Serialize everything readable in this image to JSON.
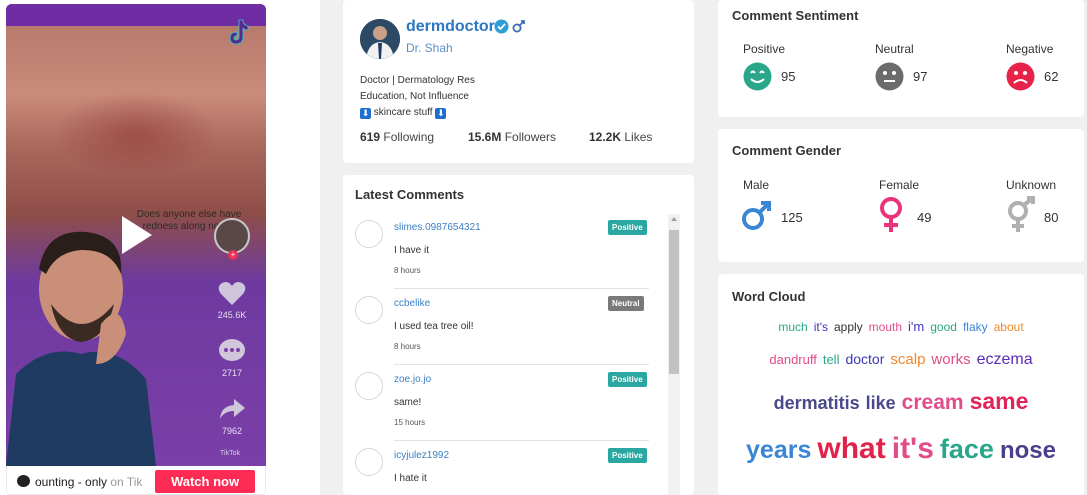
{
  "video": {
    "caption_overlay": "Does anyone else have redness along nose?",
    "likes": "245.6K",
    "comments": "2717",
    "shares": "7962",
    "watermark": "TikTok",
    "footer_text": "ounting - only",
    "footer_text_muted": " on Tik",
    "watch_label": "Watch now"
  },
  "profile": {
    "username": "dermdoctor",
    "display_name": "Dr. Shah",
    "bio_lines": [
      "Doctor | Dermatology Res",
      "Education, Not Influence",
      "skincare stuff"
    ],
    "bio_emoji": "⬇",
    "following_num": "619",
    "following_label": "Following",
    "followers_num": "15.6M",
    "followers_label": "Followers",
    "likes_num": "12.2K",
    "likes_label": "Likes"
  },
  "comments": {
    "title": "Latest Comments",
    "items": [
      {
        "user": "slimes.0987654321",
        "text": "I have it",
        "time": "8 hours",
        "badge": "Positive",
        "badge_color": "#2aa7a0"
      },
      {
        "user": "ccbelike",
        "text": "I used tea tree oil!",
        "time": "8 hours",
        "badge": "Neutral",
        "badge_color": "#7a7a7a"
      },
      {
        "user": "zoe.jo.jo",
        "text": "same!",
        "time": "15 hours",
        "badge": "Positive",
        "badge_color": "#2aa7a0"
      },
      {
        "user": "icyjulez1992",
        "text": "I hate it",
        "time": "",
        "badge": "Positive",
        "badge_color": "#2aa7a0"
      }
    ]
  },
  "sentiment": {
    "title": "Comment Sentiment",
    "positive_label": "Positive",
    "positive_value": "95",
    "positive_color": "#2aa78a",
    "neutral_label": "Neutral",
    "neutral_value": "97",
    "neutral_color": "#6b6b6b",
    "negative_label": "Negative",
    "negative_value": "62",
    "negative_color": "#e8234a"
  },
  "gender": {
    "title": "Comment Gender",
    "male_label": "Male",
    "male_value": "125",
    "male_color": "#3a86d6",
    "female_label": "Female",
    "female_value": "49",
    "female_color": "#e8347a",
    "unknown_label": "Unknown",
    "unknown_value": "80",
    "unknown_color": "#b0b0b0"
  },
  "wordcloud": {
    "title": "Word Cloud",
    "rows": [
      [
        {
          "w": "much",
          "c": "#2aa78a",
          "s": 12
        },
        {
          "w": "it's",
          "c": "#3f36b8",
          "s": 12
        },
        {
          "w": "apply",
          "c": "#333333",
          "s": 12
        },
        {
          "w": "mouth",
          "c": "#e04d8a",
          "s": 12
        },
        {
          "w": "i'm",
          "c": "#3f36b8",
          "s": 13
        },
        {
          "w": "good",
          "c": "#2aa78a",
          "s": 12
        },
        {
          "w": "flaky",
          "c": "#3a86d6",
          "s": 12
        },
        {
          "w": "about",
          "c": "#f0882a",
          "s": 12
        }
      ],
      [
        {
          "w": "dandruff",
          "c": "#e04d8a",
          "s": 13
        },
        {
          "w": "tell",
          "c": "#2aa78a",
          "s": 13
        },
        {
          "w": "doctor",
          "c": "#3f36b8",
          "s": 14
        },
        {
          "w": "scalp",
          "c": "#f0882a",
          "s": 15
        },
        {
          "w": "works",
          "c": "#e04d8a",
          "s": 15
        },
        {
          "w": "eczema",
          "c": "#5a2ab8",
          "s": 16
        }
      ],
      [
        {
          "w": "dermatitis",
          "c": "#4a4a8a",
          "s": 18
        },
        {
          "w": "like",
          "c": "#4a4a8a",
          "s": 18
        },
        {
          "w": "cream",
          "c": "#e04d8a",
          "s": 21
        },
        {
          "w": "same",
          "c": "#e0235a",
          "s": 23
        }
      ],
      [
        {
          "w": "years",
          "c": "#3a86d6",
          "s": 25
        },
        {
          "w": "what",
          "c": "#e0234a",
          "s": 30
        },
        {
          "w": "it's",
          "c": "#e04d8a",
          "s": 30
        },
        {
          "w": "face",
          "c": "#2aa78a",
          "s": 27
        },
        {
          "w": "nose",
          "c": "#4a3f8a",
          "s": 24
        }
      ]
    ]
  }
}
